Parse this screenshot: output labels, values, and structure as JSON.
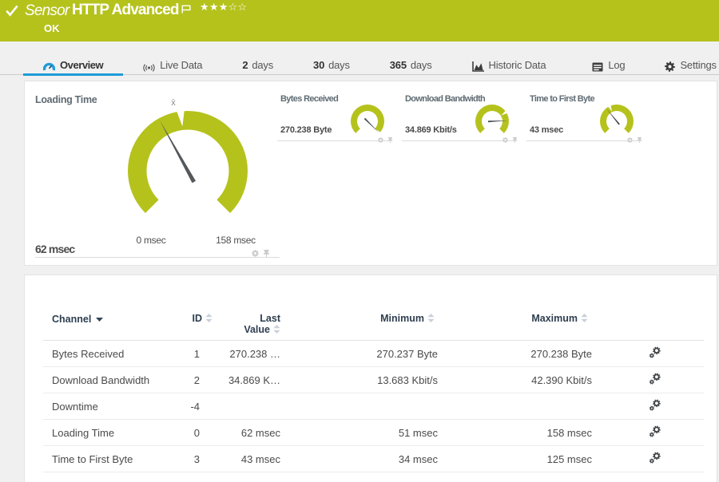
{
  "colors": {
    "green": "#b5c21c",
    "blue": "#1e9cd8",
    "needle": "#55585b",
    "page_background": "#f0f0f1",
    "status_ok_green": "#b5c21c"
  },
  "header": {
    "type_label": "Sensor",
    "name": "HTTP Advanced",
    "status": "OK",
    "rating": {
      "filled": 3,
      "total": 5
    }
  },
  "tabs": [
    {
      "label": "Overview",
      "icon": "gauge",
      "active": true
    },
    {
      "label": "Live Data",
      "icon": "live",
      "active": false
    },
    {
      "num": "2",
      "label": "days",
      "active": false
    },
    {
      "num": "30",
      "label": "days",
      "active": false
    },
    {
      "num": "365",
      "label": "days",
      "active": false
    },
    {
      "label": "Historic Data",
      "icon": "chart",
      "active": false
    },
    {
      "label": "Log",
      "icon": "log",
      "active": false
    },
    {
      "label": "Settings",
      "icon": "gear",
      "active": false
    }
  ],
  "chart_data": [
    {
      "type": "gauge",
      "title": "Loading Time",
      "value": 62,
      "unit": "msec",
      "value_label": "62 msec",
      "scale_min": 0,
      "scale_max": 158,
      "scale_min_label": "0 msec",
      "scale_max_label": "158 msec",
      "avg_marker_value": 75,
      "avg_marker_label": "x̄"
    },
    {
      "type": "gauge",
      "title": "Bytes Received",
      "value": 270.238,
      "unit": "Byte",
      "value_label": "270.238 Byte",
      "scale_min": 0,
      "scale_max": 270.238,
      "avg_marker_value": 270.1
    },
    {
      "type": "gauge",
      "title": "Download Bandwidth",
      "value": 34.869,
      "unit": "Kbit/s",
      "value_label": "34.869 Kbit/s",
      "scale_min": 0,
      "scale_max": 42.39,
      "avg_marker_value": 30.1
    },
    {
      "type": "gauge",
      "title": "Time to First Byte",
      "value": 43,
      "unit": "msec",
      "value_label": "43 msec",
      "scale_min": 0,
      "scale_max": 121,
      "avg_marker_value": 49
    }
  ],
  "table": {
    "columns": [
      {
        "key": "channel",
        "label": "Channel",
        "sorted": "desc"
      },
      {
        "key": "id",
        "label": "ID",
        "sorted": null
      },
      {
        "key": "last",
        "label": "Last Value",
        "sorted": null
      },
      {
        "key": "min",
        "label": "Minimum",
        "sorted": null
      },
      {
        "key": "max",
        "label": "Maximum",
        "sorted": null
      }
    ],
    "rows": [
      {
        "channel": "Bytes Received",
        "id": "1",
        "last": "270.238 …",
        "min": "270.237 Byte",
        "max": "270.238 Byte"
      },
      {
        "channel": "Download Bandwidth",
        "id": "2",
        "last": "34.869 K…",
        "min": "13.683 Kbit/s",
        "max": "42.390 Kbit/s"
      },
      {
        "channel": "Downtime",
        "id": "-4",
        "last": "",
        "min": "",
        "max": ""
      },
      {
        "channel": "Loading Time",
        "id": "0",
        "last": "62 msec",
        "min": "51 msec",
        "max": "158 msec"
      },
      {
        "channel": "Time to First Byte",
        "id": "3",
        "last": "43 msec",
        "min": "34 msec",
        "max": "125 msec"
      }
    ]
  }
}
